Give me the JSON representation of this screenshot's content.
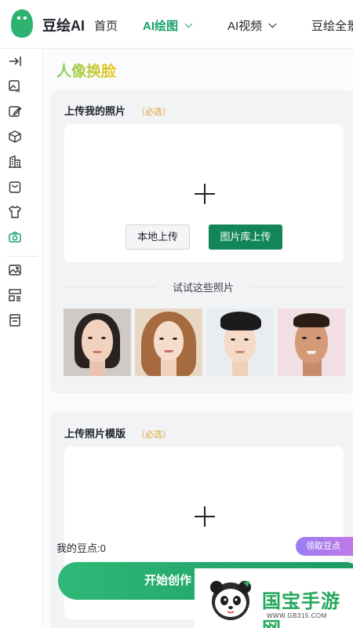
{
  "header": {
    "brand": "豆绘AI",
    "nav": [
      {
        "label": "首页",
        "active": false,
        "dropdown": false
      },
      {
        "label": "AI绘图",
        "active": true,
        "dropdown": true
      },
      {
        "label": "AI视频",
        "active": false,
        "dropdown": true
      },
      {
        "label": "豆绘全景",
        "active": false,
        "dropdown": false
      }
    ]
  },
  "sidebar": {
    "icons": [
      "collapse-icon",
      "ai-image-icon",
      "edit-image-icon",
      "cube-icon",
      "building-icon",
      "bag-icon",
      "shirt-icon",
      "camera-icon",
      "gallery-icon",
      "layout-icon",
      "document-icon"
    ],
    "active": "camera-icon"
  },
  "page": {
    "title": "人像换脸"
  },
  "upload_photo": {
    "title": "上传我的照片",
    "required": "（必选）",
    "local_upload": "本地上传",
    "gallery_upload": "图片库上传",
    "try_label": "试试这些照片"
  },
  "upload_template": {
    "title": "上传照片模版",
    "required": "（必选）"
  },
  "footer": {
    "points": "我的豆点:0",
    "claim": "领取豆点",
    "start": "开始创作"
  },
  "watermark": {
    "title": "国宝手游网",
    "url": "WWW.GB315.COM"
  },
  "colors": {
    "accent": "#1aa06a",
    "gallery_button": "#138659",
    "claim_start": "#9b7cf3",
    "claim_end": "#c17ae6",
    "required": "#e0a33a"
  }
}
